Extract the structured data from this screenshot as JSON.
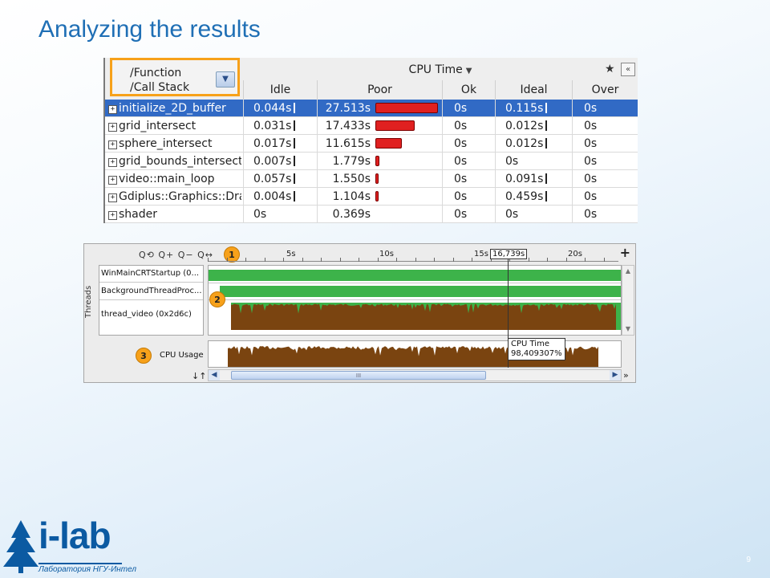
{
  "slide": {
    "title": "Analyzing the results",
    "page_number": "9"
  },
  "table": {
    "func_header_line1": "/Function",
    "func_header_line2": "/Call Stack",
    "group_header": "CPU Time",
    "columns": [
      "Idle",
      "Poor",
      "Ok",
      "Ideal",
      "Over"
    ],
    "rows": [
      {
        "name": "initialize_2D_buffer",
        "idle": "0.044s",
        "poor": "27.513s",
        "ok": "0s",
        "ideal": "0.115s",
        "over": "0s",
        "poor_fraction": 1.0,
        "idle_tick": true,
        "ideal_tick": true,
        "selected": true
      },
      {
        "name": "grid_intersect",
        "idle": "0.031s",
        "poor": "17.433s",
        "ok": "0s",
        "ideal": "0.012s",
        "over": "0s",
        "poor_fraction": 0.634,
        "idle_tick": true,
        "ideal_tick": true,
        "selected": false
      },
      {
        "name": "sphere_intersect",
        "idle": "0.017s",
        "poor": "11.615s",
        "ok": "0s",
        "ideal": "0.012s",
        "over": "0s",
        "poor_fraction": 0.422,
        "idle_tick": true,
        "ideal_tick": true,
        "selected": false
      },
      {
        "name": "grid_bounds_intersect",
        "idle": "0.007s",
        "poor": "1.779s",
        "ok": "0s",
        "ideal": "0s",
        "over": "0s",
        "poor_fraction": 0.065,
        "idle_tick": true,
        "ideal_tick": false,
        "selected": false
      },
      {
        "name": "video::main_loop",
        "idle": "0.057s",
        "poor": "1.550s",
        "ok": "0s",
        "ideal": "0.091s",
        "over": "0s",
        "poor_fraction": 0.056,
        "idle_tick": true,
        "ideal_tick": true,
        "selected": false
      },
      {
        "name": "Gdiplus::Graphics::Dra",
        "idle": "0.004s",
        "poor": "1.104s",
        "ok": "0s",
        "ideal": "0.459s",
        "over": "0s",
        "poor_fraction": 0.04,
        "idle_tick": true,
        "ideal_tick": true,
        "selected": false
      },
      {
        "name": "shader",
        "idle": "0s",
        "poor": "0.369s",
        "ok": "0s",
        "ideal": "0s",
        "over": "0s",
        "poor_fraction": 0.0,
        "idle_tick": false,
        "ideal_tick": false,
        "selected": false
      }
    ]
  },
  "timeline": {
    "zoom_tools": "Q⟲ Q+ Q− Q↔",
    "ruler_labels": [
      "5s",
      "10s",
      "15s",
      "20s"
    ],
    "cursor_time": "16,739s",
    "threads_label": "Threads",
    "threads": [
      "WinMainCRTStartup (0...",
      "BackgroundThreadProc...",
      "thread_video (0x2d6c)"
    ],
    "cpu_usage_label": "CPU Usage",
    "tooltip_line1": "CPU Time",
    "tooltip_line2": "98,409307%",
    "callouts": [
      "1",
      "2",
      "3"
    ],
    "scroll_thumb_grip": "III",
    "sort_icon": "↓↑",
    "more_icon": "»",
    "plus_corner": "+"
  },
  "footer": {
    "logo_text": "i-lab",
    "logo_subtitle": "Лаборатория НГУ-Интел"
  },
  "colors": {
    "title": "#1f6fb5",
    "highlight": "#f7a11a",
    "poor_bar": "#e02020",
    "selected_row": "#316ac5",
    "thread_green": "#3db34a",
    "cpu_brown": "#7a4410"
  }
}
